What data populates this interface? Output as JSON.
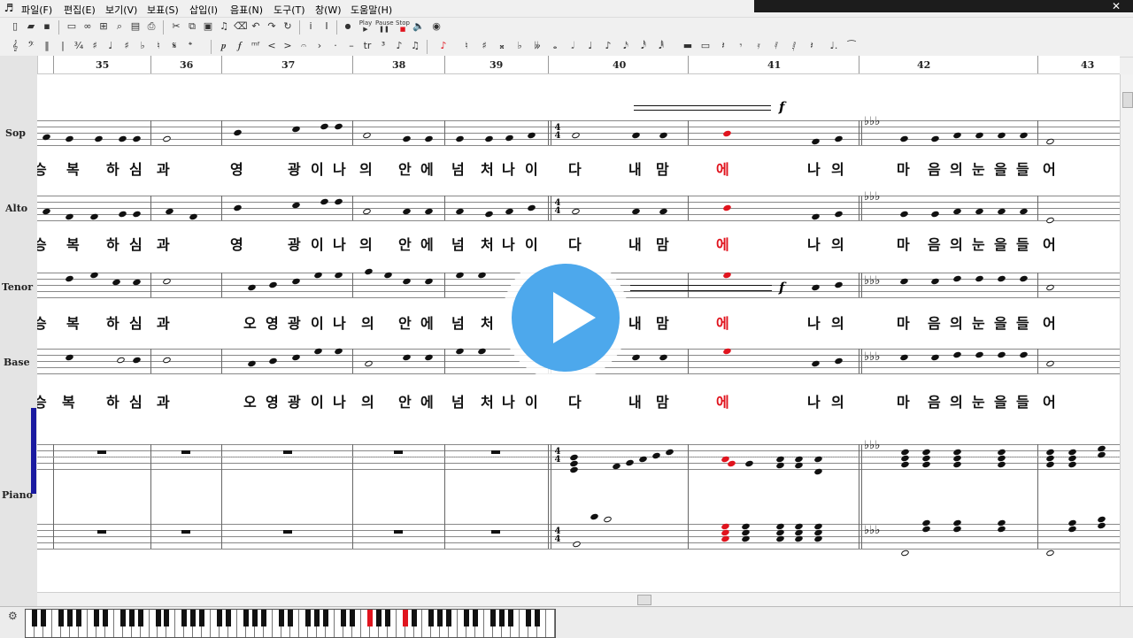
{
  "menubar": {
    "items": [
      "파일(F)",
      "편집(E)",
      "보기(V)",
      "보표(S)",
      "삽입(I)",
      "음표(N)",
      "도구(T)",
      "창(W)",
      "도움말(H)"
    ]
  },
  "toolbar": {
    "play_label": "Play",
    "pause_label": "Pause",
    "stop_label": "Stop"
  },
  "ruler": {
    "measures": [
      "35",
      "36",
      "37",
      "38",
      "39",
      "40",
      "41",
      "42",
      "43"
    ]
  },
  "staves": {
    "names": [
      "Sop",
      "Alto",
      "Tenor",
      "Base",
      "Piano"
    ]
  },
  "lyrics": {
    "sop": [
      "승",
      "복",
      "하",
      "심",
      "과",
      "영",
      "광",
      "이",
      "나",
      "의",
      "안",
      "에",
      "넘",
      "처",
      "나",
      "이",
      "다",
      "내",
      "맘",
      "에",
      "나",
      "의",
      "마",
      "음",
      "의",
      "눈",
      "을",
      "들",
      "어"
    ],
    "alto": [
      "승",
      "복",
      "하",
      "심",
      "과",
      "영",
      "광",
      "이",
      "나",
      "의",
      "안",
      "에",
      "넘",
      "처",
      "나",
      "이",
      "다",
      "내",
      "맘",
      "에",
      "나",
      "의",
      "마",
      "음",
      "의",
      "눈",
      "을",
      "들",
      "어"
    ],
    "tenor": [
      "승",
      "복",
      "하",
      "심",
      "과",
      "오",
      "영",
      "광",
      "이",
      "나",
      "의",
      "안",
      "에",
      "넘",
      "처",
      "내",
      "맘",
      "에",
      "나",
      "의",
      "마",
      "음",
      "의",
      "눈",
      "을",
      "들",
      "어"
    ],
    "base": [
      "승",
      "복",
      "하",
      "심",
      "과",
      "오",
      "영",
      "광",
      "이",
      "나",
      "의",
      "안",
      "에",
      "넘",
      "처",
      "나",
      "이",
      "다",
      "내",
      "맘",
      "에",
      "나",
      "의",
      "마",
      "음",
      "의",
      "눈",
      "을",
      "들",
      "어"
    ]
  },
  "dynamics": {
    "forte": "f"
  },
  "time_signature": {
    "top": "4",
    "bottom": "4"
  },
  "colors": {
    "highlight": "#e0141e",
    "play_button": "#4da8ec",
    "piano_selector": "#1a1aa0"
  }
}
